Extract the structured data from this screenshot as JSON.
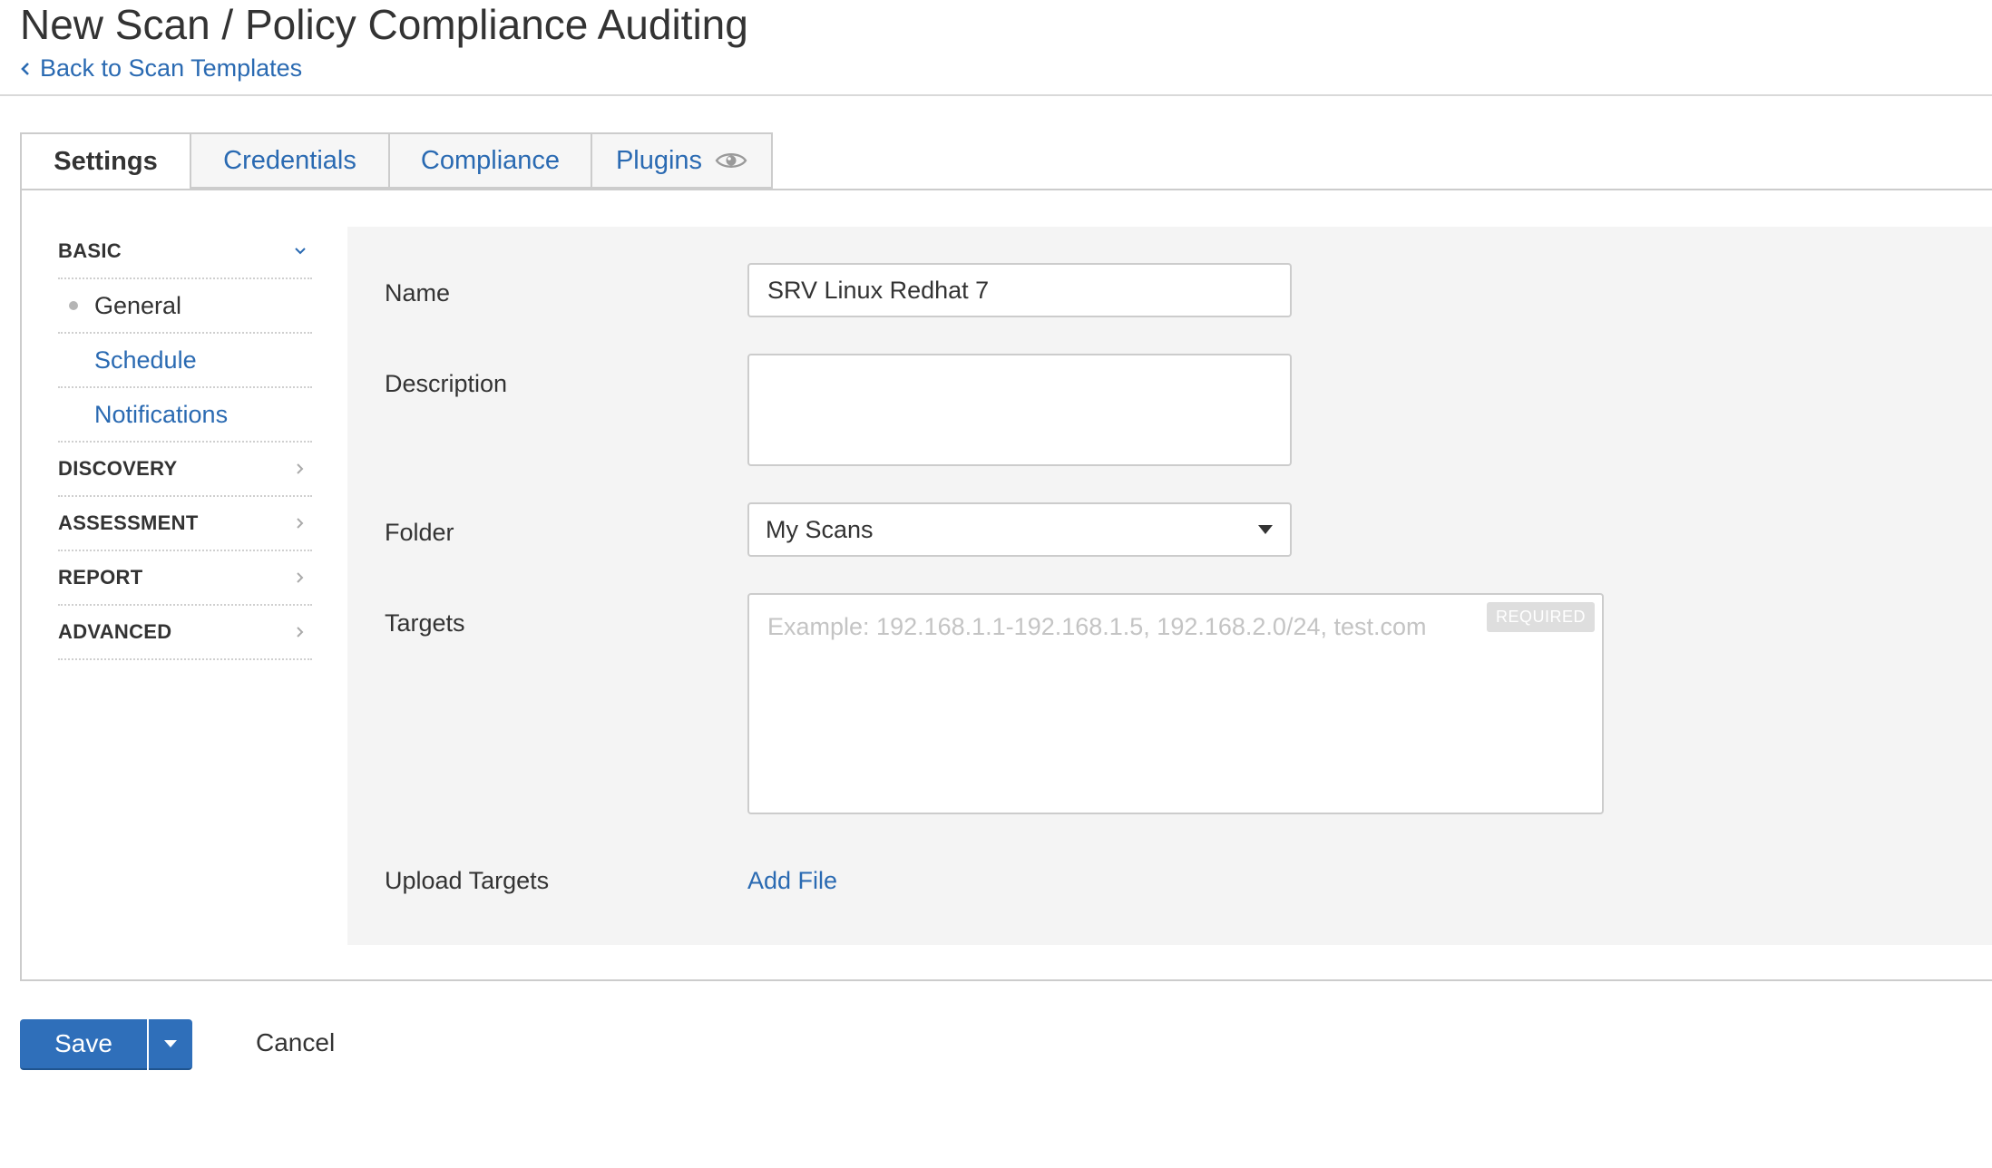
{
  "header": {
    "title": "New Scan / Policy Compliance Auditing",
    "back_link": "Back to Scan Templates"
  },
  "tabs": [
    {
      "label": "Settings",
      "active": true
    },
    {
      "label": "Credentials",
      "active": false
    },
    {
      "label": "Compliance",
      "active": false
    },
    {
      "label": "Plugins",
      "active": false,
      "icon": "eye-icon"
    }
  ],
  "leftnav": {
    "basic": {
      "label": "BASIC",
      "expanded": true,
      "items": [
        {
          "label": "General",
          "current": true
        },
        {
          "label": "Schedule",
          "current": false
        },
        {
          "label": "Notifications",
          "current": false
        }
      ]
    },
    "sections": [
      {
        "label": "DISCOVERY"
      },
      {
        "label": "ASSESSMENT"
      },
      {
        "label": "REPORT"
      },
      {
        "label": "ADVANCED"
      }
    ]
  },
  "form": {
    "name": {
      "label": "Name",
      "value": "SRV Linux Redhat 7"
    },
    "description": {
      "label": "Description",
      "value": ""
    },
    "folder": {
      "label": "Folder",
      "value": "My Scans"
    },
    "targets": {
      "label": "Targets",
      "placeholder": "Example: 192.168.1.1-192.168.1.5, 192.168.2.0/24, test.com",
      "badge": "REQUIRED",
      "value": ""
    },
    "upload_targets": {
      "label": "Upload Targets",
      "action": "Add File"
    }
  },
  "actions": {
    "save": "Save",
    "cancel": "Cancel"
  },
  "colors": {
    "link": "#2a6ab2",
    "primary_button": "#2f6fba",
    "form_background": "#f4f4f4",
    "border": "#cccccc"
  }
}
